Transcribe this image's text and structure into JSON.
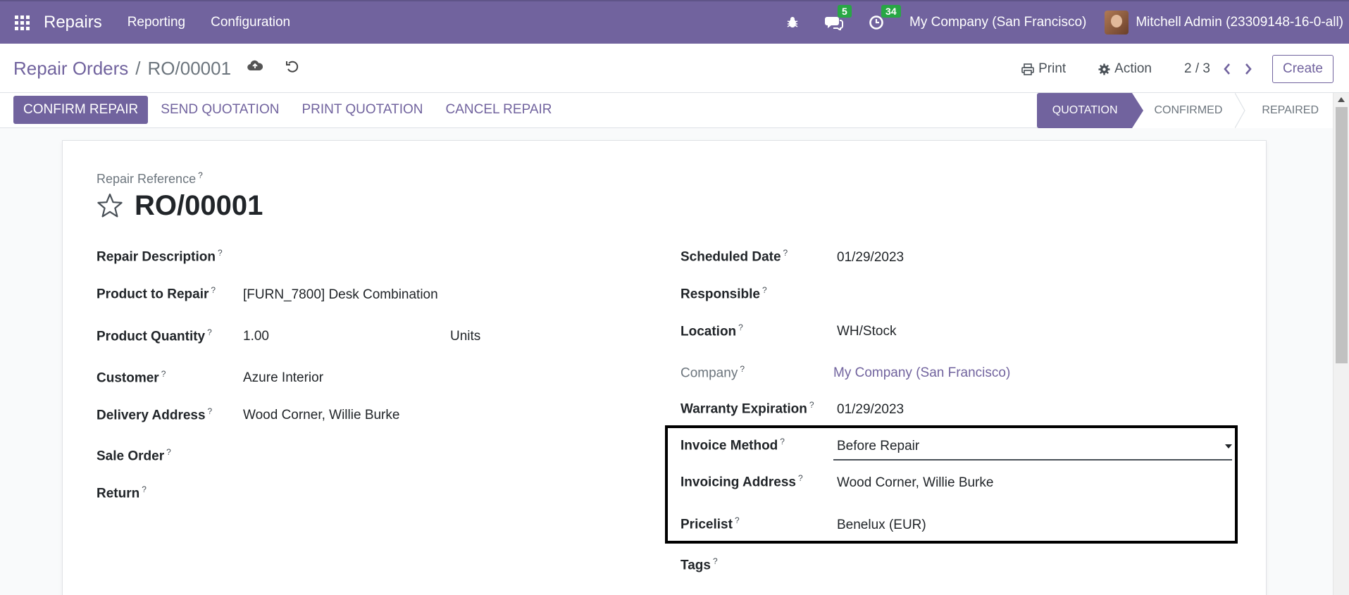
{
  "navbar": {
    "brand": "Repairs",
    "menus": [
      "Reporting",
      "Configuration"
    ],
    "messages_count": "5",
    "activities_count": "34",
    "company": "My Company (San Francisco)",
    "user": "Mitchell Admin (23309148-16-0-all)"
  },
  "breadcrumb": {
    "parent": "Repair Orders",
    "separator": "/",
    "current": "RO/00001"
  },
  "control": {
    "print_label": "Print",
    "action_label": "Action",
    "pager": "2 / 3",
    "create_label": "Create"
  },
  "actions": {
    "confirm": "CONFIRM REPAIR",
    "send_quotation": "SEND QUOTATION",
    "print_quotation": "PRINT QUOTATION",
    "cancel": "CANCEL REPAIR"
  },
  "stages": {
    "quotation": "QUOTATION",
    "confirmed": "CONFIRMED",
    "repaired": "REPAIRED"
  },
  "form": {
    "reference_label": "Repair Reference",
    "reference": "RO/00001",
    "help_mark": "?",
    "left": {
      "description_label": "Repair Description",
      "product_label": "Product to Repair",
      "product_value": "[FURN_7800] Desk Combination",
      "quantity_label": "Product Quantity",
      "quantity_value": "1.00",
      "uom_value": "Units",
      "customer_label": "Customer",
      "customer_value": "Azure Interior",
      "delivery_label": "Delivery Address",
      "delivery_value": "Wood Corner, Willie Burke",
      "sale_order_label": "Sale Order",
      "return_label": "Return"
    },
    "right": {
      "scheduled_label": "Scheduled Date",
      "scheduled_value": "01/29/2023",
      "responsible_label": "Responsible",
      "location_label": "Location",
      "location_value": "WH/Stock",
      "company_label": "Company",
      "company_value": "My Company (San Francisco)",
      "warranty_label": "Warranty Expiration",
      "warranty_value": "01/29/2023",
      "invoice_method_label": "Invoice Method",
      "invoice_method_value": "Before Repair",
      "invoicing_address_label": "Invoicing Address",
      "invoicing_address_value": "Wood Corner, Willie Burke",
      "pricelist_label": "Pricelist",
      "pricelist_value": "Benelux (EUR)",
      "tags_label": "Tags"
    }
  },
  "colors": {
    "brand": "#71639e",
    "badge": "#28a745",
    "highlight_box": "#000000"
  }
}
